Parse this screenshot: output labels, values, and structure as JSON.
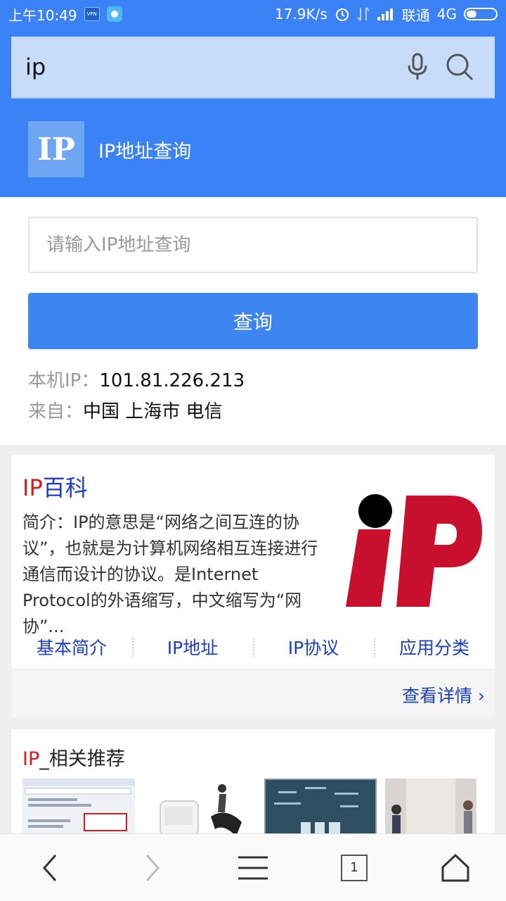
{
  "status_bar": {
    "time": "上午10:49",
    "vpn_badge": "VPN",
    "net_speed": "17.9K/s",
    "carrier": "联通",
    "network": "4G"
  },
  "search": {
    "query": "ip",
    "voice_icon": "microphone-icon",
    "search_icon": "search-icon"
  },
  "ip_tool": {
    "logo_text": "IP",
    "title": "IP地址查询",
    "input_placeholder": "请输入IP地址查询",
    "button_label": "查询",
    "local_ip_label": "本机IP：",
    "local_ip_value": "101.81.226.213",
    "from_label": "来自：",
    "from_value": "中国 上海市 电信"
  },
  "baike": {
    "title_red": "IP",
    "title_rest": "百科",
    "description": "简介：IP的意思是“网络之间互连的协议”，也就是为计算机网络相互连接进行通信而设计的协议。是Internet Protocol的外语缩写，中文缩写为“网协”...",
    "links": [
      "基本简介",
      "IP地址",
      "IP协议",
      "应用分类"
    ],
    "view_more": "查看详情 ›",
    "brand_red": "#c8102e"
  },
  "related": {
    "title_red": "IP",
    "title_rest": "_相关推荐"
  },
  "bottom_nav": {
    "back_icon": "back-chevron-icon",
    "forward_icon": "forward-chevron-icon",
    "menu_icon": "menu-icon",
    "tab_count": "1",
    "home_icon": "home-icon"
  },
  "colors": {
    "primary": "#3b82f6",
    "link": "#1a3fc0",
    "accent_red": "#d61a1a"
  }
}
